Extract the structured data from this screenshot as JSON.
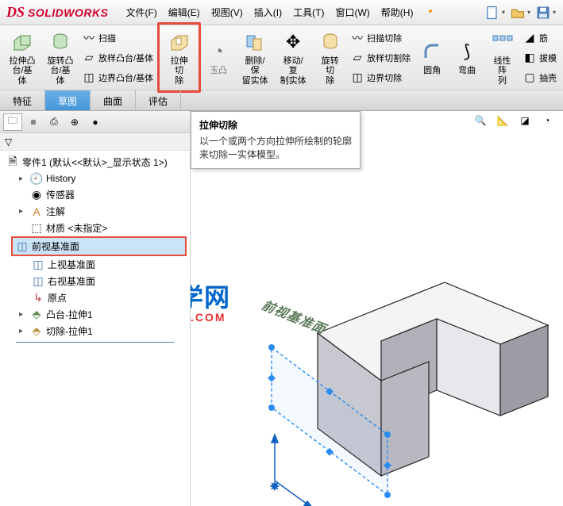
{
  "app": {
    "logo_text": "SOLIDWORKS",
    "logo_glyph": "DS"
  },
  "menu": {
    "file": "文件(F)",
    "edit": "编辑(E)",
    "view": "视图(V)",
    "insert": "插入(I)",
    "tools": "工具(T)",
    "window": "窗口(W)",
    "help": "帮助(H)"
  },
  "ribbon": {
    "extrude_boss": "拉伸凸\n台/基体",
    "revolve_boss": "旋转凸\n台/基体",
    "sweep": "扫描",
    "loft": "放样凸台/基体",
    "boundary": "边界凸台/基体",
    "extrude_cut": "拉伸切\n除",
    "wizard_cut": "玉凸",
    "delete_keep": "删除/保\n留实体",
    "move_copy": "移动/复\n制实体",
    "revolve_cut": "旋转切\n除",
    "sweep_cut": "扫描切除",
    "loft_cut": "放样切割除",
    "boundary_cut": "边界切除",
    "fillet": "圆角",
    "bend": "弯曲",
    "linear_pattern": "线性阵\n列",
    "rib": "筋",
    "draft": "拔模",
    "shell": "抽壳"
  },
  "tabs": {
    "feature": "特征",
    "sketch": "草图",
    "surface": "曲面",
    "evaluate": "评估"
  },
  "tooltip": {
    "title": "拉伸切除",
    "body": "以一个或两个方向拉伸所绘制的轮廓来切除一实体模型。"
  },
  "tree": {
    "root": "零件1 (默认<<默认>_显示状态 1>)",
    "history": "History",
    "sensors": "传感器",
    "annotations": "注解",
    "material": "材质 <未指定>",
    "front_plane": "前视基准面",
    "top_plane": "上视基准面",
    "right_plane": "右视基准面",
    "origin": "原点",
    "boss_extrude1": "凸台-拉伸1",
    "cut_extrude1": "切除-拉伸1"
  },
  "viewport": {
    "plane_label": "前视基准面"
  },
  "watermark": {
    "cn": "软件自学网",
    "en": "WWW.RJZXW.COM"
  }
}
